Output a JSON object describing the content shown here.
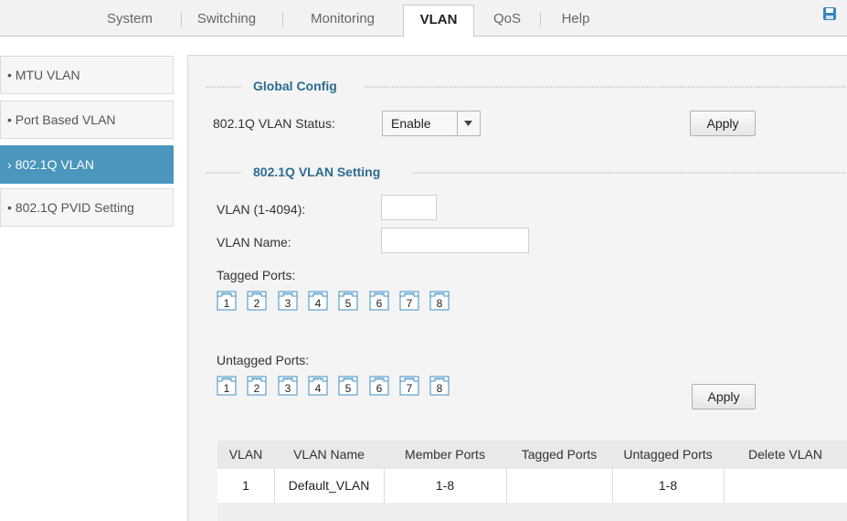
{
  "nav": {
    "tabs": [
      "System",
      "Switching",
      "Monitoring",
      "VLAN",
      "QoS",
      "Help"
    ],
    "active": "VLAN",
    "save_icon": "save-icon"
  },
  "sidebar": {
    "items": [
      {
        "bullet": "•",
        "label": "MTU VLAN"
      },
      {
        "bullet": "•",
        "label": "Port Based VLAN"
      },
      {
        "bullet": "›",
        "label": "802.1Q VLAN"
      },
      {
        "bullet": "•",
        "label": "802.1Q PVID Setting"
      }
    ],
    "active_index": 2,
    "active_color": "#4a96bd"
  },
  "global_config": {
    "title": "Global Config",
    "status_label": "802.1Q VLAN Status:",
    "status_value": "Enable",
    "apply_label": "Apply"
  },
  "vlan_setting": {
    "title": "802.1Q VLAN Setting",
    "vlan_id_label": "VLAN (1-4094):",
    "vlan_id_value": "",
    "vlan_name_label": "VLAN Name:",
    "vlan_name_value": "",
    "tagged_label": "Tagged Ports:",
    "untagged_label": "Untagged Ports:",
    "ports": [
      "1",
      "2",
      "3",
      "4",
      "5",
      "6",
      "7",
      "8"
    ],
    "apply_label": "Apply"
  },
  "table": {
    "headers": [
      "VLAN",
      "VLAN Name",
      "Member Ports",
      "Tagged Ports",
      "Untagged Ports",
      "Delete VLAN"
    ],
    "rows": [
      {
        "vlan": "1",
        "name": "Default_VLAN",
        "member": "1-8",
        "tagged": "",
        "untagged": "1-8",
        "delete": ""
      }
    ]
  },
  "colors": {
    "accent": "#2b6c92",
    "port_icon": "#3d8fc4"
  }
}
